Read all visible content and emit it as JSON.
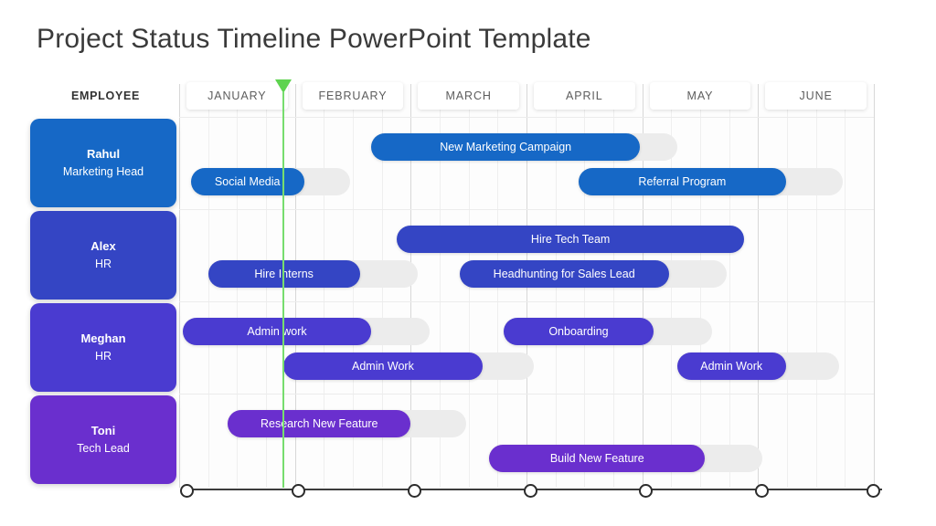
{
  "title": "Project Status Timeline PowerPoint Template",
  "employee_column": {
    "header": "EMPLOYEE"
  },
  "months": [
    {
      "label": "JANUARY"
    },
    {
      "label": "FEBRUARY"
    },
    {
      "label": "MARCH"
    },
    {
      "label": "APRIL"
    },
    {
      "label": "MAY"
    },
    {
      "label": "JUNE"
    }
  ],
  "employees": [
    {
      "name": "Rahul",
      "role": "Marketing Head",
      "color": "#1668C6"
    },
    {
      "name": "Alex",
      "role": "HR",
      "color": "#3445C4"
    },
    {
      "name": "Meghan",
      "role": "HR",
      "color": "#4A3BD0"
    },
    {
      "name": "Toni",
      "role": "Tech Lead",
      "color": "#6A2FCE"
    }
  ],
  "tasks": [
    {
      "label": "New Marketing Campaign",
      "row": 0,
      "lane": 0,
      "color": "#1668C6"
    },
    {
      "label": "Social Media",
      "row": 0,
      "lane": 1,
      "color": "#1668C6"
    },
    {
      "label": "Referral Program",
      "row": 0,
      "lane": 1,
      "color": "#1668C6"
    },
    {
      "label": "Hire Tech Team",
      "row": 1,
      "lane": 0,
      "color": "#3445C4"
    },
    {
      "label": "Hire Interns",
      "row": 1,
      "lane": 1,
      "color": "#3445C4"
    },
    {
      "label": "Headhunting for Sales Lead",
      "row": 1,
      "lane": 1,
      "color": "#3445C4"
    },
    {
      "label": "Admin work",
      "row": 2,
      "lane": 0,
      "color": "#4A3BD0"
    },
    {
      "label": "Onboarding",
      "row": 2,
      "lane": 0,
      "color": "#4A3BD0"
    },
    {
      "label": "Admin Work",
      "row": 2,
      "lane": 1,
      "color": "#4A3BD0"
    },
    {
      "label": "Admin Work",
      "row": 2,
      "lane": 1,
      "color": "#4A3BD0"
    },
    {
      "label": "Research New Feature",
      "row": 3,
      "lane": 0,
      "color": "#6A2FCE"
    },
    {
      "label": "Build New Feature",
      "row": 3,
      "lane": 1,
      "color": "#6A2FCE"
    }
  ],
  "chart_data": {
    "type": "bar",
    "chart_style": "gantt-timeline",
    "title": "Project Status Timeline PowerPoint Template",
    "xlabel": "",
    "ylabel": "EMPLOYEE",
    "x_axis": {
      "categories": [
        "JANUARY",
        "FEBRUARY",
        "MARCH",
        "APRIL",
        "MAY",
        "JUNE"
      ],
      "range_months": [
        1,
        6
      ],
      "grid": true,
      "minor_gridlines_per_month": 4
    },
    "categories": [
      "Rahul / Marketing Head",
      "Alex / HR",
      "Meghan / HR",
      "Toni / Tech Lead"
    ],
    "legend": "none",
    "colors": {
      "row_1": "#1668C6",
      "row_2": "#3445C4",
      "row_3": "#4A3BD0",
      "row_4": "#6A2FCE",
      "remaining_track": "#ECECEC",
      "today_marker": "#5ED34F",
      "title_text": "#3A3A3A",
      "background": "#FFFFFF"
    },
    "today_marker": {
      "label": "",
      "position_month": 1.9,
      "color": "#5ED34F"
    },
    "series": [
      {
        "name": "Rahul / Marketing Head",
        "color": "#1668C6",
        "values": [
          {
            "task": "New Marketing Campaign",
            "start_month": 2.66,
            "end_month": 4.98,
            "track_end_month": 5.3,
            "lane": 0
          },
          {
            "task": "Social Media",
            "start_month": 1.1,
            "end_month": 2.08,
            "track_end_month": 2.48,
            "lane": 1
          },
          {
            "task": "Referral Program",
            "start_month": 4.45,
            "end_month": 6.24,
            "track_end_month": 6.73,
            "lane": 1
          }
        ]
      },
      {
        "name": "Alex / HR",
        "color": "#3445C4",
        "values": [
          {
            "task": "Hire Tech Team",
            "start_month": 2.88,
            "end_month": 5.88,
            "track_end_month": 5.88,
            "lane": 0
          },
          {
            "task": "Hire Interns",
            "start_month": 1.25,
            "end_month": 2.56,
            "track_end_month": 3.06,
            "lane": 1
          },
          {
            "task": "Headhunting for Sales Lead",
            "start_month": 3.42,
            "end_month": 5.23,
            "track_end_month": 5.73,
            "lane": 1
          }
        ]
      },
      {
        "name": "Meghan / HR",
        "color": "#4A3BD0",
        "values": [
          {
            "task": "Admin work",
            "start_month": 1.03,
            "end_month": 2.66,
            "track_end_month": 3.16,
            "lane": 0
          },
          {
            "task": "Onboarding",
            "start_month": 3.8,
            "end_month": 5.1,
            "track_end_month": 5.6,
            "lane": 0
          },
          {
            "task": "Admin Work",
            "start_month": 1.9,
            "end_month": 3.62,
            "track_end_month": 4.06,
            "lane": 1
          },
          {
            "task": "Admin Work",
            "start_month": 5.3,
            "end_month": 6.24,
            "track_end_month": 6.7,
            "lane": 1
          }
        ]
      },
      {
        "name": "Toni / Tech Lead",
        "color": "#6A2FCE",
        "values": [
          {
            "task": "Research New Feature",
            "start_month": 1.42,
            "end_month": 3.0,
            "track_end_month": 3.48,
            "lane": 0
          },
          {
            "task": "Build New Feature",
            "start_month": 3.68,
            "end_month": 5.54,
            "track_end_month": 6.04,
            "lane": 1
          }
        ]
      }
    ]
  }
}
